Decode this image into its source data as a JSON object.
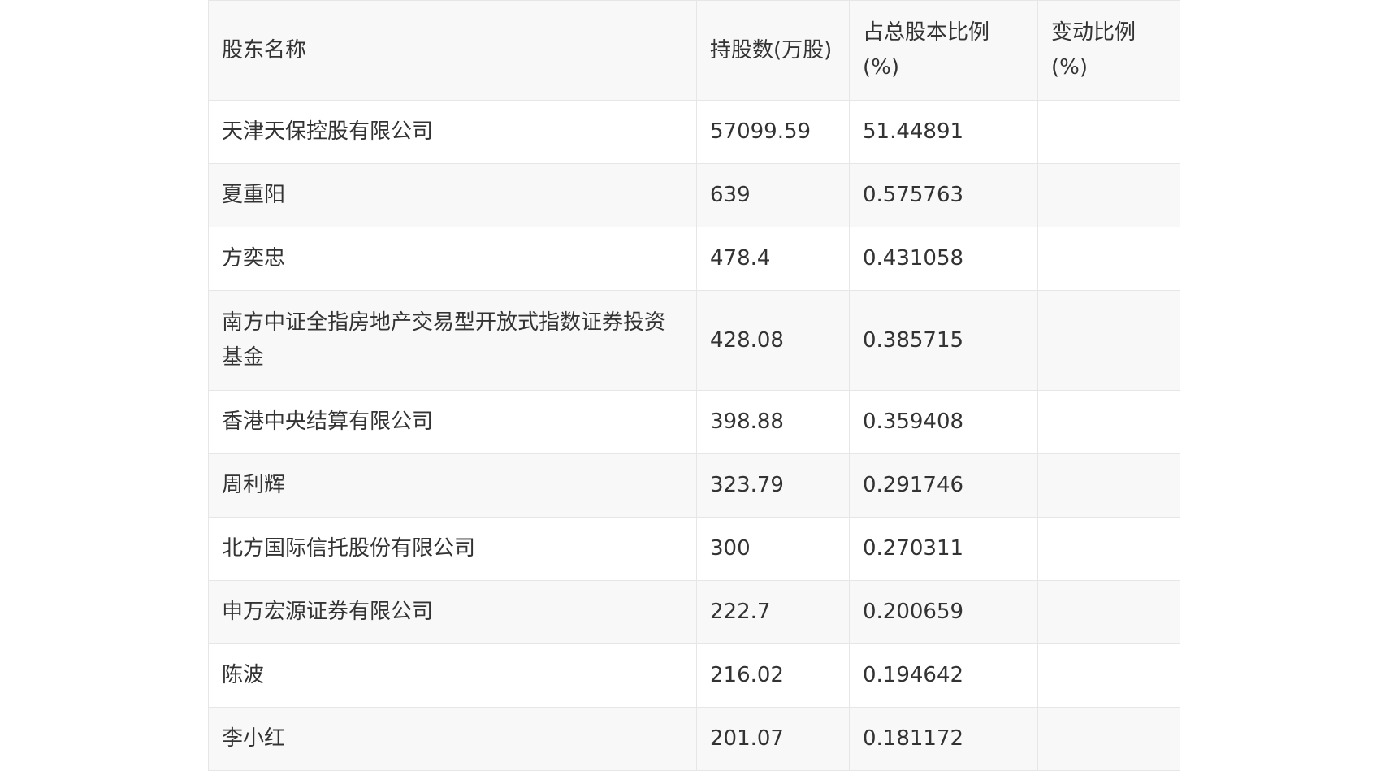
{
  "table": {
    "headers": [
      "股东名称",
      "持股数(万股)",
      "占总股本比例(%)",
      "变动比例(%)"
    ],
    "rows": [
      [
        "天津天保控股有限公司",
        "57099.59",
        "51.44891",
        ""
      ],
      [
        "夏重阳",
        "639",
        "0.575763",
        ""
      ],
      [
        "方奕忠",
        "478.4",
        "0.431058",
        ""
      ],
      [
        "南方中证全指房地产交易型开放式指数证券投资基金",
        "428.08",
        "0.385715",
        ""
      ],
      [
        "香港中央结算有限公司",
        "398.88",
        "0.359408",
        ""
      ],
      [
        "周利辉",
        "323.79",
        "0.291746",
        ""
      ],
      [
        "北方国际信托股份有限公司",
        "300",
        "0.270311",
        ""
      ],
      [
        "申万宏源证券有限公司",
        "222.7",
        "0.200659",
        ""
      ],
      [
        "陈波",
        "216.02",
        "0.194642",
        ""
      ],
      [
        "李小红",
        "201.07",
        "0.181172",
        ""
      ]
    ]
  }
}
